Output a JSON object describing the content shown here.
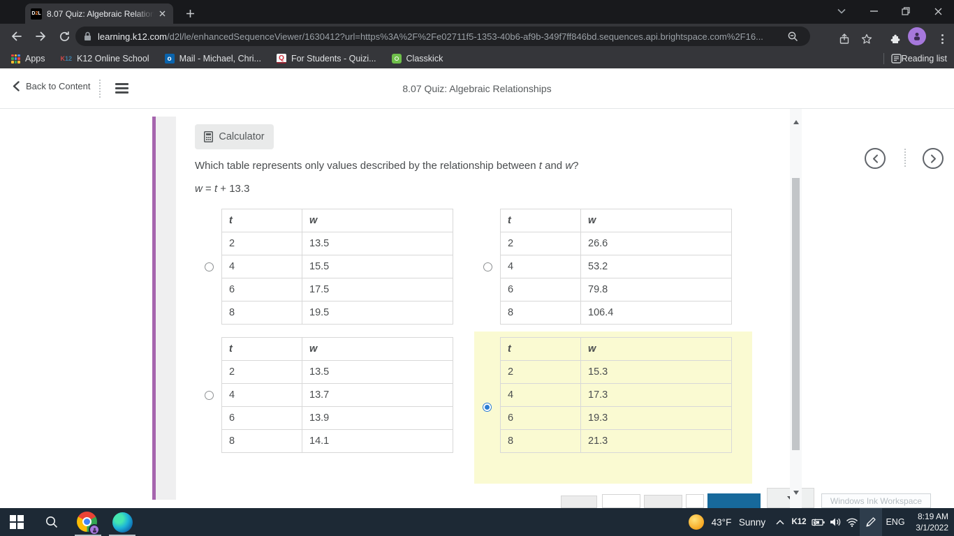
{
  "browser": {
    "tab": {
      "favicon_text": "D2L",
      "title": "8.07 Quiz: Algebraic Relationships"
    },
    "url": {
      "domain": "learning.k12.com",
      "path": "/d2l/le/enhancedSequenceViewer/1630412?url=https%3A%2F%2Fe02711f5-1353-40b6-af9b-349f7ff846bd.sequences.api.brightspace.com%2F16..."
    },
    "bookmarks": [
      {
        "label": "Apps"
      },
      {
        "label": "K12 Online School",
        "icon_text": "K12"
      },
      {
        "label": "Mail - Michael, Chri...",
        "icon_text": "o"
      },
      {
        "label": "For Students - Quizi...",
        "icon_text": "Q"
      },
      {
        "label": "Classkick"
      }
    ],
    "reading_list_label": "Reading list"
  },
  "quiz_header": {
    "back_label": "Back to Content",
    "title": "8.07 Quiz: Algebraic Relationships"
  },
  "content": {
    "calculator_label": "Calculator",
    "question": {
      "pre": "Which table represents only values described by the relationship between ",
      "var1": "t",
      "mid": " and ",
      "var2": "w",
      "post": "?"
    },
    "equation": {
      "lhs": "w",
      "op": " = ",
      "var": "t",
      "rest": " + 13.3"
    }
  },
  "options": [
    {
      "headers": {
        "c1": "t",
        "c2": "w"
      },
      "selected": false,
      "rows": [
        {
          "t": "2",
          "w": "13.5"
        },
        {
          "t": "4",
          "w": "15.5"
        },
        {
          "t": "6",
          "w": "17.5"
        },
        {
          "t": "8",
          "w": "19.5"
        }
      ]
    },
    {
      "headers": {
        "c1": "t",
        "c2": "w"
      },
      "selected": false,
      "rows": [
        {
          "t": "2",
          "w": "26.6"
        },
        {
          "t": "4",
          "w": "53.2"
        },
        {
          "t": "6",
          "w": "79.8"
        },
        {
          "t": "8",
          "w": "106.4"
        }
      ]
    },
    {
      "headers": {
        "c1": "t",
        "c2": "w"
      },
      "selected": false,
      "rows": [
        {
          "t": "2",
          "w": "13.5"
        },
        {
          "t": "4",
          "w": "13.7"
        },
        {
          "t": "6",
          "w": "13.9"
        },
        {
          "t": "8",
          "w": "14.1"
        }
      ]
    },
    {
      "headers": {
        "c1": "t",
        "c2": "w"
      },
      "selected": true,
      "rows": [
        {
          "t": "2",
          "w": "15.3"
        },
        {
          "t": "4",
          "w": "17.3"
        },
        {
          "t": "6",
          "w": "19.3"
        },
        {
          "t": "8",
          "w": "21.3"
        }
      ]
    }
  ],
  "tooltip": "Windows Ink Workspace",
  "taskbar": {
    "weather_temp": "43°F",
    "weather_condition": "Sunny",
    "tray_label": "K12",
    "language": "ENG",
    "time": "8:19 AM",
    "date": "3/1/2022"
  },
  "colors": {
    "selected_highlight": "#fafad2",
    "accent_purple": "#a665ae",
    "radio_selected": "#2b7cd3",
    "partial_button_blue": "#17699b"
  }
}
